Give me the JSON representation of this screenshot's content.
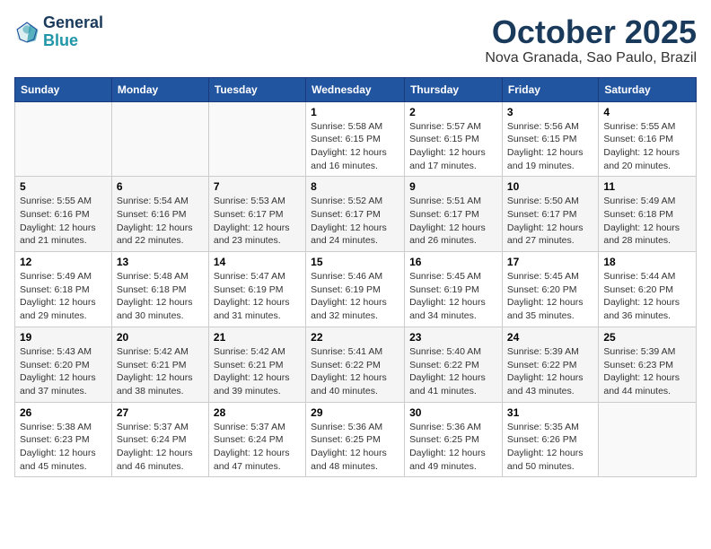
{
  "logo": {
    "line1": "General",
    "line2": "Blue"
  },
  "title": "October 2025",
  "subtitle": "Nova Granada, Sao Paulo, Brazil",
  "weekdays": [
    "Sunday",
    "Monday",
    "Tuesday",
    "Wednesday",
    "Thursday",
    "Friday",
    "Saturday"
  ],
  "weeks": [
    [
      {
        "day": "",
        "info": ""
      },
      {
        "day": "",
        "info": ""
      },
      {
        "day": "",
        "info": ""
      },
      {
        "day": "1",
        "info": "Sunrise: 5:58 AM\nSunset: 6:15 PM\nDaylight: 12 hours\nand 16 minutes."
      },
      {
        "day": "2",
        "info": "Sunrise: 5:57 AM\nSunset: 6:15 PM\nDaylight: 12 hours\nand 17 minutes."
      },
      {
        "day": "3",
        "info": "Sunrise: 5:56 AM\nSunset: 6:15 PM\nDaylight: 12 hours\nand 19 minutes."
      },
      {
        "day": "4",
        "info": "Sunrise: 5:55 AM\nSunset: 6:16 PM\nDaylight: 12 hours\nand 20 minutes."
      }
    ],
    [
      {
        "day": "5",
        "info": "Sunrise: 5:55 AM\nSunset: 6:16 PM\nDaylight: 12 hours\nand 21 minutes."
      },
      {
        "day": "6",
        "info": "Sunrise: 5:54 AM\nSunset: 6:16 PM\nDaylight: 12 hours\nand 22 minutes."
      },
      {
        "day": "7",
        "info": "Sunrise: 5:53 AM\nSunset: 6:17 PM\nDaylight: 12 hours\nand 23 minutes."
      },
      {
        "day": "8",
        "info": "Sunrise: 5:52 AM\nSunset: 6:17 PM\nDaylight: 12 hours\nand 24 minutes."
      },
      {
        "day": "9",
        "info": "Sunrise: 5:51 AM\nSunset: 6:17 PM\nDaylight: 12 hours\nand 26 minutes."
      },
      {
        "day": "10",
        "info": "Sunrise: 5:50 AM\nSunset: 6:17 PM\nDaylight: 12 hours\nand 27 minutes."
      },
      {
        "day": "11",
        "info": "Sunrise: 5:49 AM\nSunset: 6:18 PM\nDaylight: 12 hours\nand 28 minutes."
      }
    ],
    [
      {
        "day": "12",
        "info": "Sunrise: 5:49 AM\nSunset: 6:18 PM\nDaylight: 12 hours\nand 29 minutes."
      },
      {
        "day": "13",
        "info": "Sunrise: 5:48 AM\nSunset: 6:18 PM\nDaylight: 12 hours\nand 30 minutes."
      },
      {
        "day": "14",
        "info": "Sunrise: 5:47 AM\nSunset: 6:19 PM\nDaylight: 12 hours\nand 31 minutes."
      },
      {
        "day": "15",
        "info": "Sunrise: 5:46 AM\nSunset: 6:19 PM\nDaylight: 12 hours\nand 32 minutes."
      },
      {
        "day": "16",
        "info": "Sunrise: 5:45 AM\nSunset: 6:19 PM\nDaylight: 12 hours\nand 34 minutes."
      },
      {
        "day": "17",
        "info": "Sunrise: 5:45 AM\nSunset: 6:20 PM\nDaylight: 12 hours\nand 35 minutes."
      },
      {
        "day": "18",
        "info": "Sunrise: 5:44 AM\nSunset: 6:20 PM\nDaylight: 12 hours\nand 36 minutes."
      }
    ],
    [
      {
        "day": "19",
        "info": "Sunrise: 5:43 AM\nSunset: 6:20 PM\nDaylight: 12 hours\nand 37 minutes."
      },
      {
        "day": "20",
        "info": "Sunrise: 5:42 AM\nSunset: 6:21 PM\nDaylight: 12 hours\nand 38 minutes."
      },
      {
        "day": "21",
        "info": "Sunrise: 5:42 AM\nSunset: 6:21 PM\nDaylight: 12 hours\nand 39 minutes."
      },
      {
        "day": "22",
        "info": "Sunrise: 5:41 AM\nSunset: 6:22 PM\nDaylight: 12 hours\nand 40 minutes."
      },
      {
        "day": "23",
        "info": "Sunrise: 5:40 AM\nSunset: 6:22 PM\nDaylight: 12 hours\nand 41 minutes."
      },
      {
        "day": "24",
        "info": "Sunrise: 5:39 AM\nSunset: 6:22 PM\nDaylight: 12 hours\nand 43 minutes."
      },
      {
        "day": "25",
        "info": "Sunrise: 5:39 AM\nSunset: 6:23 PM\nDaylight: 12 hours\nand 44 minutes."
      }
    ],
    [
      {
        "day": "26",
        "info": "Sunrise: 5:38 AM\nSunset: 6:23 PM\nDaylight: 12 hours\nand 45 minutes."
      },
      {
        "day": "27",
        "info": "Sunrise: 5:37 AM\nSunset: 6:24 PM\nDaylight: 12 hours\nand 46 minutes."
      },
      {
        "day": "28",
        "info": "Sunrise: 5:37 AM\nSunset: 6:24 PM\nDaylight: 12 hours\nand 47 minutes."
      },
      {
        "day": "29",
        "info": "Sunrise: 5:36 AM\nSunset: 6:25 PM\nDaylight: 12 hours\nand 48 minutes."
      },
      {
        "day": "30",
        "info": "Sunrise: 5:36 AM\nSunset: 6:25 PM\nDaylight: 12 hours\nand 49 minutes."
      },
      {
        "day": "31",
        "info": "Sunrise: 5:35 AM\nSunset: 6:26 PM\nDaylight: 12 hours\nand 50 minutes."
      },
      {
        "day": "",
        "info": ""
      }
    ]
  ]
}
